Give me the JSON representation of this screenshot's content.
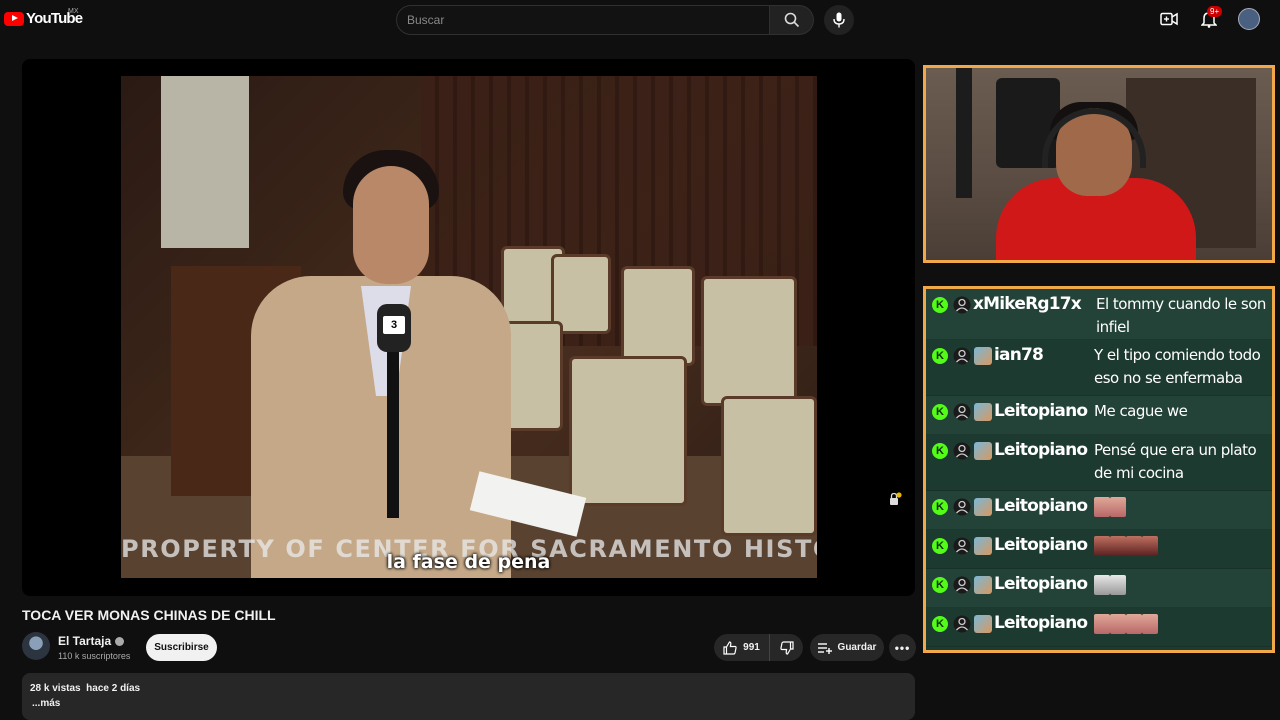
{
  "header": {
    "logo_text": "YouTube",
    "country": "MX",
    "search_placeholder": "Buscar",
    "notif_count": "9+"
  },
  "player": {
    "watermark": "PROPERTY OF CENTER FOR SACRAMENTO HISTORY",
    "subtitle": "la fase de pena",
    "mic_logo": "3"
  },
  "video": {
    "title": "TOCA VER MONAS CHINAS DE CHILL",
    "channel_name": "El Tartaja",
    "subscribers": "110 k suscriptores",
    "subscribe_label": "Suscribirse",
    "like_count": "991",
    "save_label": "Guardar",
    "description_meta": "28 k vistas  hace 2 días",
    "more_label": "...más"
  },
  "chat": {
    "messages": [
      {
        "user": "xMikeRg17x",
        "badge": false,
        "text": "El tommy cuando le son infiel",
        "emotes": 0
      },
      {
        "user": "ian78",
        "badge": true,
        "text": "Y el tipo comiendo todo eso no se enfermaba",
        "emotes": 0
      },
      {
        "user": "Leitopiano",
        "badge": true,
        "text": "Me cague we",
        "emotes": 0
      },
      {
        "user": "Leitopiano",
        "badge": true,
        "text": "Pensé que era un plato de mi cocina",
        "emotes": 0
      },
      {
        "user": "Leitopiano",
        "badge": true,
        "text": "",
        "emotes": 2,
        "emote_style": "face"
      },
      {
        "user": "Leitopiano",
        "badge": true,
        "text": "",
        "emotes": 4,
        "emote_style": "dark"
      },
      {
        "user": "Leitopiano",
        "badge": true,
        "text": "",
        "emotes": 2,
        "emote_style": "cat"
      },
      {
        "user": "Leitopiano",
        "badge": true,
        "text": "",
        "emotes": 4,
        "emote_style": "face"
      }
    ]
  },
  "colors": {
    "accent_border": "#f0a848",
    "kick_green": "#53fc18",
    "chat_bg": "#1e3a32"
  }
}
